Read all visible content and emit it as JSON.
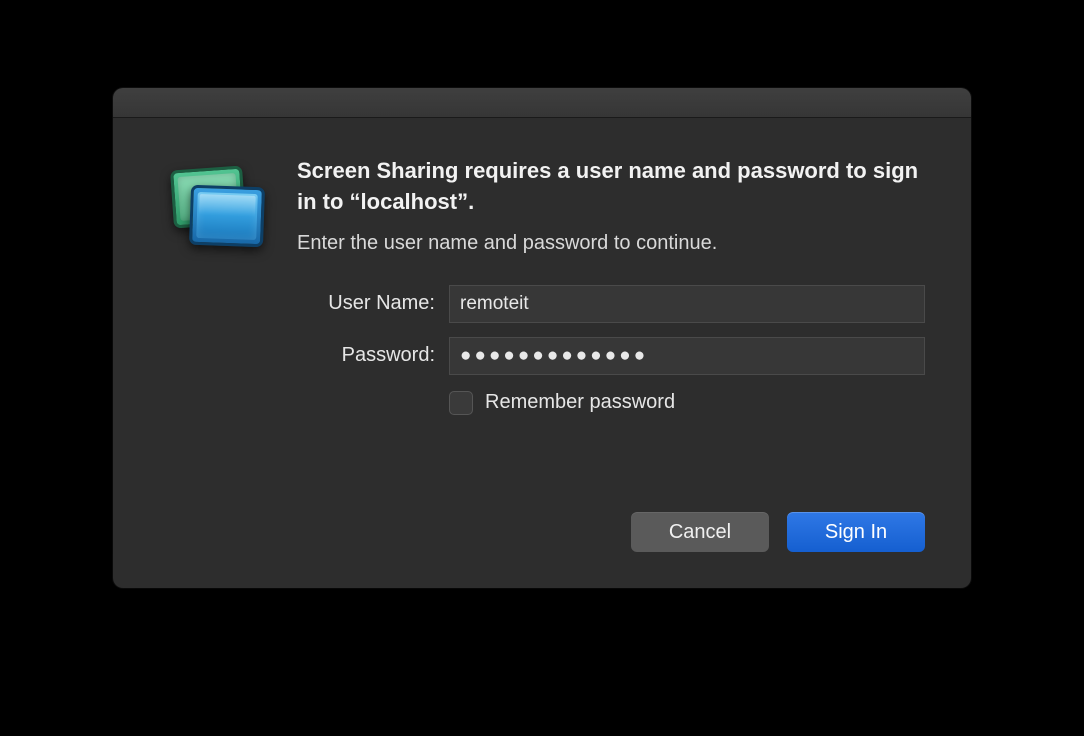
{
  "dialog": {
    "heading": "Screen Sharing requires a user name and password to sign in to “localhost”.",
    "subheading": "Enter the user name and password to continue.",
    "form": {
      "username_label": "User Name:",
      "username_value": "remoteit",
      "password_label": "Password:",
      "password_mask": "●●●●●●●●●●●●●",
      "remember_label": "Remember password",
      "remember_checked": false
    },
    "buttons": {
      "cancel": "Cancel",
      "primary": "Sign In"
    },
    "icon": "screen-sharing-icon"
  }
}
